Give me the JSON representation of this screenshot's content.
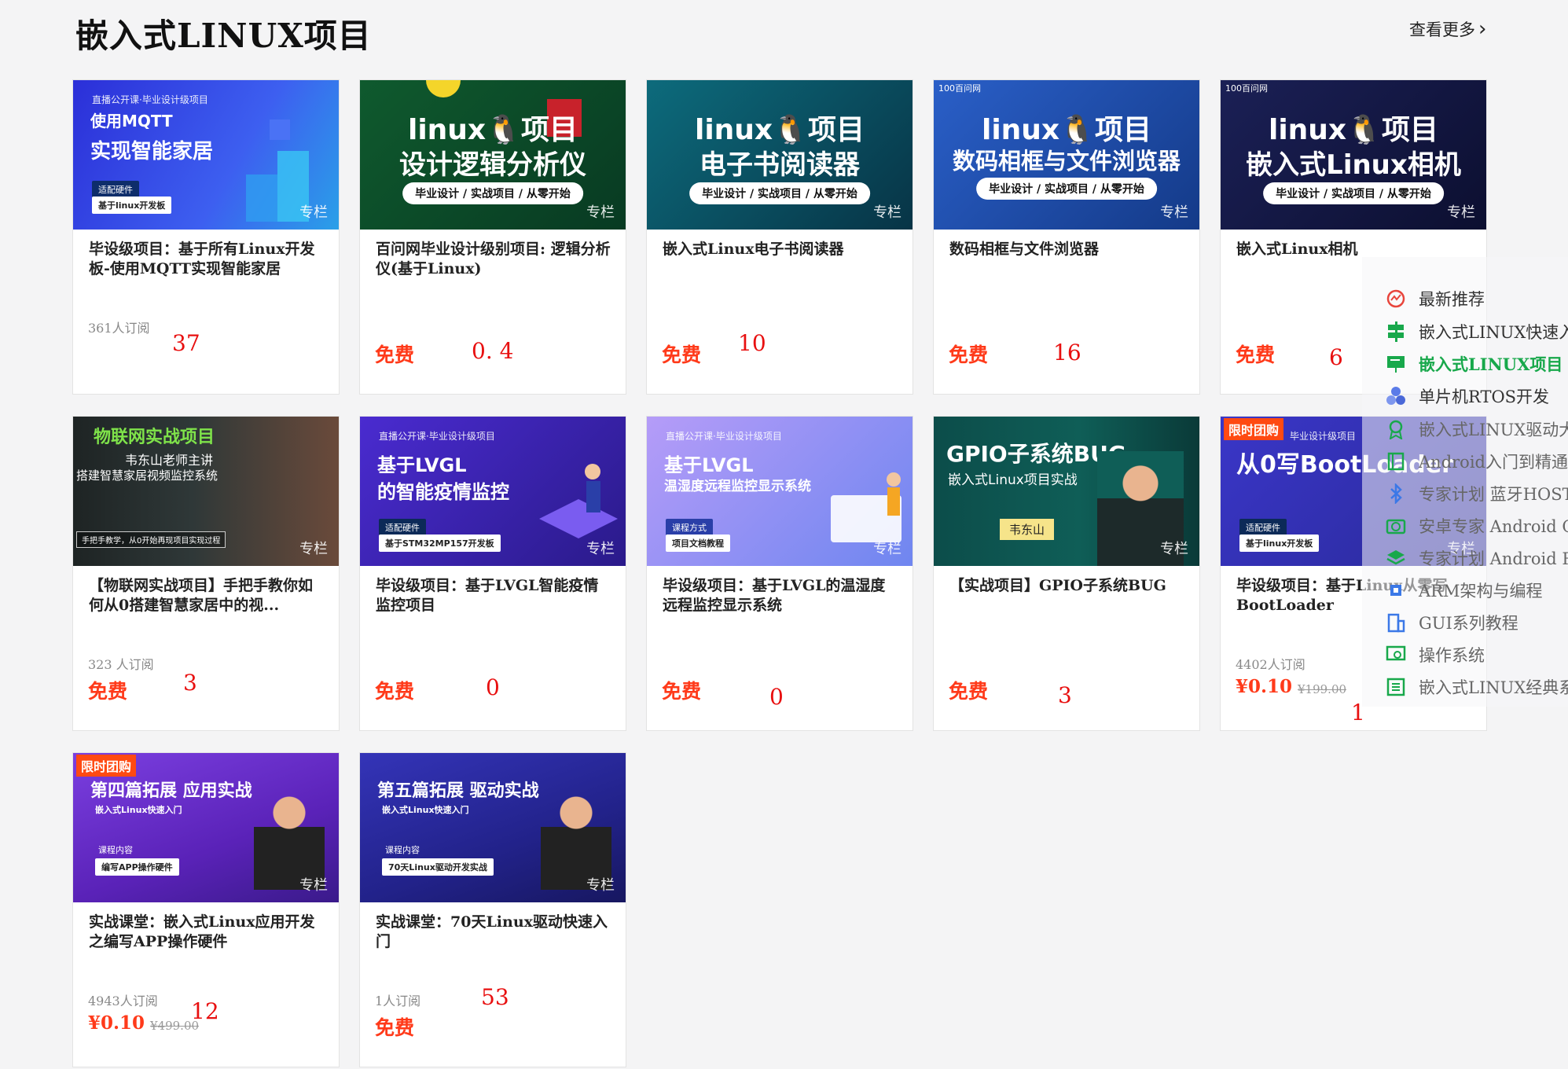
{
  "section": {
    "title": "嵌入式LINUX项目",
    "more_label": "查看更多"
  },
  "cards": [
    {
      "thumb": {
        "top_text": "直播公开课·毕业设计级项目",
        "line1": "使用MQTT",
        "line2": "实现智能家居",
        "chip_label": "适配硬件",
        "chip_value": "基于linux开发板",
        "type": "专栏",
        "bg": "#2f47e0"
      },
      "title": "毕设级项目：基于所有Linux开发板-使用MQTT实现智能家居",
      "subscribers": "361人订阅",
      "price": "",
      "old_price": "",
      "annotation": "37"
    },
    {
      "thumb": {
        "line1": "linux",
        "line1b": "项目",
        "line2": "设计逻辑分析仪",
        "pill": "毕业设计 / 实战项目 / 从零开始",
        "type": "专栏",
        "bg": "#0f4a2a"
      },
      "title": "百问网毕业设计级别项目: 逻辑分析仪(基于Linux)",
      "subscribers": "",
      "price": "免费",
      "old_price": "",
      "annotation": "0. 4"
    },
    {
      "thumb": {
        "line1": "linux",
        "line1b": "项目",
        "line2": "电子书阅读器",
        "pill": "毕业设计 / 实战项目 / 从零开始",
        "type": "专栏",
        "bg": "#0c4b60"
      },
      "title": "嵌入式Linux电子书阅读器",
      "subscribers": "",
      "price": "免费",
      "old_price": "",
      "annotation": "10"
    },
    {
      "thumb": {
        "brand": "100百问网",
        "line1": "linux",
        "line1b": "项目",
        "line2": "数码相框与文件浏览器",
        "pill": "毕业设计 / 实战项目 / 从零开始",
        "type": "专栏",
        "bg": "#1a4aa8"
      },
      "title": "数码相框与文件浏览器",
      "subscribers": "",
      "price": "免费",
      "old_price": "",
      "annotation": "16"
    },
    {
      "thumb": {
        "brand": "100百问网",
        "line1": "linux",
        "line1b": "项目",
        "line2": "嵌入式Linux相机",
        "pill": "毕业设计 / 实战项目 / 从零开始",
        "type": "专栏",
        "bg": "#131a4a"
      },
      "title": "嵌入式Linux相机",
      "subscribers": "",
      "price": "免费",
      "old_price": "",
      "annotation": "6"
    },
    {
      "thumb": {
        "line1": "物联网实战项目",
        "line2": "韦东山老师主讲",
        "line3": "搭建智慧家居视频监控系统",
        "bar": "手把手教学，从0开始再现项目实现过程",
        "type": "专栏",
        "bg": "#2a2f2f"
      },
      "title": "【物联网实战项目】手把手教你如何从0搭建智慧家居中的视...",
      "subscribers": "323 人订阅",
      "price": "免费",
      "old_price": "",
      "annotation": "3"
    },
    {
      "thumb": {
        "top_text": "直播公开课·毕业设计级项目",
        "line1": "基于LVGL",
        "line2": "的智能疫情监控",
        "chip_label": "适配硬件",
        "chip_value": "基于STM32MP157开发板",
        "type": "专栏",
        "bg": "#4b2bc8"
      },
      "title": "毕设级项目：基于LVGL智能疫情监控项目",
      "subscribers": "",
      "price": "免费",
      "old_price": "",
      "annotation": "0"
    },
    {
      "thumb": {
        "top_text": "直播公开课·毕业设计级项目",
        "line1": "基于LVGL",
        "line2": "温湿度远程监控显示系统",
        "chip_label": "课程方式",
        "chip_value": "项目文档教程",
        "type": "专栏",
        "bg": "#8f88f0"
      },
      "title": "毕设级项目：基于LVGL的温湿度远程监控显示系统",
      "subscribers": "",
      "price": "免费",
      "old_price": "",
      "annotation": "0"
    },
    {
      "thumb": {
        "line1": "GPIO子系统BUG",
        "line2": "嵌入式Linux项目实战",
        "name_tag": "韦东山",
        "type": "专栏",
        "bg": "#0b4f4a"
      },
      "title": "【实战项目】GPIO子系统BUG",
      "subscribers": "",
      "price": "免费",
      "old_price": "",
      "annotation": "3"
    },
    {
      "thumb": {
        "group": "限时团购",
        "top_text": "毕业设计级项目",
        "line1": "从0写BootLoader",
        "chip_label": "适配硬件",
        "chip_value": "基于linux开发板",
        "type": "专栏",
        "bg": "#3a36c8"
      },
      "title": "毕设级项目：基于Linux从零写BootLoader",
      "subscribers": "4402人订阅",
      "price": "¥0.10",
      "old_price": "¥199.00",
      "annotation": "1"
    },
    {
      "thumb": {
        "group": "限时团购",
        "line1": "第四篇拓展 应用实战",
        "line2": "嵌入式Linux快速入门",
        "chip_label": "课程内容",
        "chip_value": "编写APP操作硬件",
        "type": "专栏",
        "bg": "#6a2fc4"
      },
      "title": "实战课堂：嵌入式Linux应用开发之编写APP操作硬件",
      "subscribers": "4943人订阅",
      "price": "¥0.10",
      "old_price": "¥499.00",
      "annotation": "12"
    },
    {
      "thumb": {
        "line1": "第五篇拓展 驱动实战",
        "line2": "嵌入式Linux快速入门",
        "chip_label": "课程内容",
        "chip_value": "70天Linux驱动开发实战",
        "type": "专栏",
        "bg": "#2a2a9a"
      },
      "title": "实战课堂：70天Linux驱动快速入门",
      "subscribers": "1人订阅",
      "price": "免费",
      "old_price": "",
      "annotation": "53"
    }
  ],
  "side_menu": [
    {
      "label": "最新推荐",
      "icon": "chart-circle-icon",
      "color": "#e8453c"
    },
    {
      "label": "嵌入式LINUX快速入",
      "icon": "signpost-icon",
      "color": "#18a84b"
    },
    {
      "label": "嵌入式LINUX项目",
      "icon": "presentation-icon",
      "color": "#18a84b"
    },
    {
      "label": "单片机RTOS开发",
      "icon": "cubes-icon",
      "color": "#5b7be8"
    },
    {
      "label": "嵌入式LINUX驱动大",
      "icon": "award-icon",
      "color": "#18a84b"
    },
    {
      "label": "Android入门到精通",
      "icon": "book-icon",
      "color": "#18a84b"
    },
    {
      "label": "专家计划 蓝牙HOST",
      "icon": "bluetooth-icon",
      "color": "#3b78e7"
    },
    {
      "label": "安卓专家 Android Ca",
      "icon": "camera-icon",
      "color": "#18a84b"
    },
    {
      "label": "专家计划 Android RO",
      "icon": "layers-icon",
      "color": "#18a84b"
    },
    {
      "label": "ARM架构与编程",
      "icon": "chip-icon",
      "color": "#3b78e7"
    },
    {
      "label": "GUI系列教程",
      "icon": "building-icon",
      "color": "#3b78e7"
    },
    {
      "label": "操作系统",
      "icon": "monitor-gear-icon",
      "color": "#18a84b"
    },
    {
      "label": "嵌入式LINUX经典系",
      "icon": "list-icon",
      "color": "#18a84b"
    }
  ]
}
